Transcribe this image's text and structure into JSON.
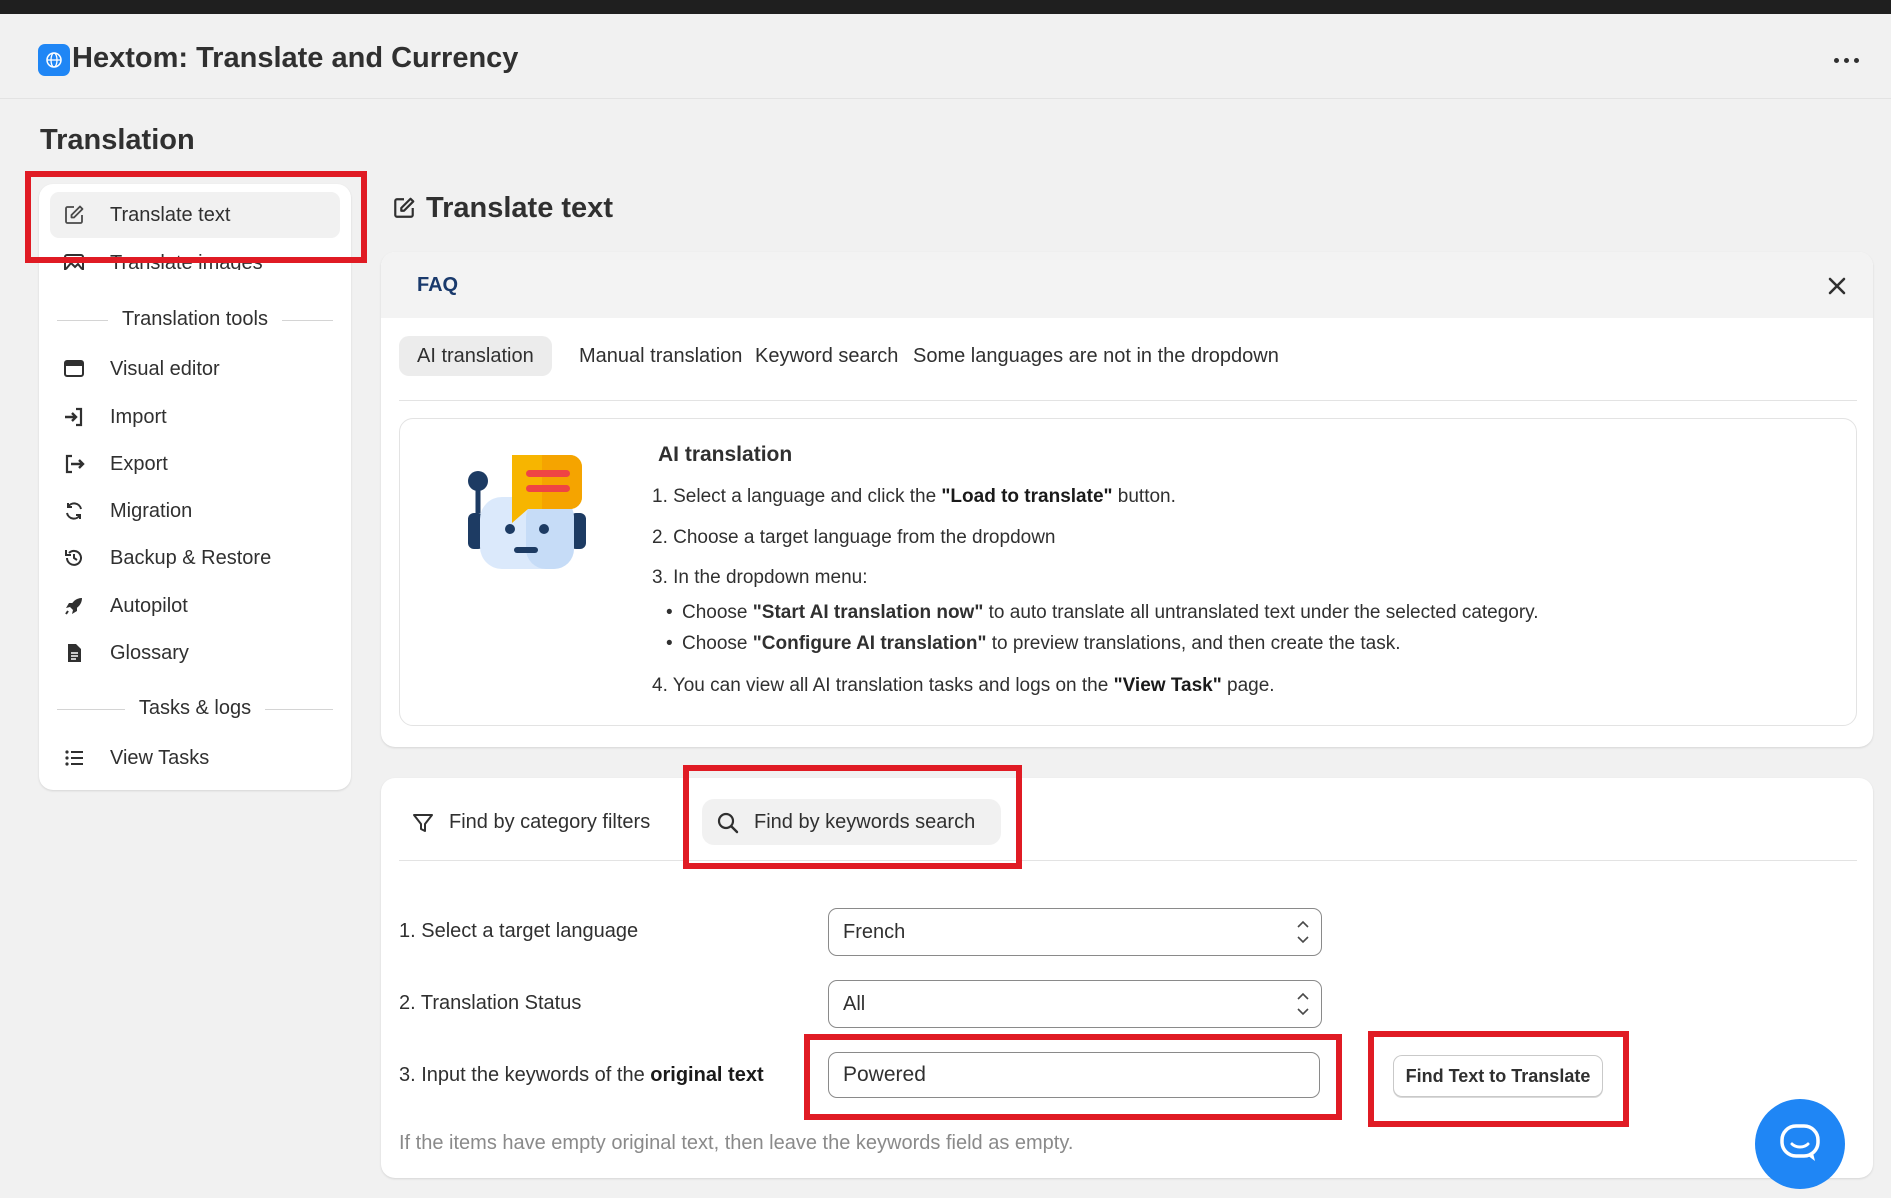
{
  "app": {
    "title": "Hextom: Translate and Currency",
    "icon": "globe-icon"
  },
  "page": {
    "section_title": "Translation"
  },
  "sidebar": {
    "items": [
      {
        "label": "Translate text",
        "icon": "edit-icon",
        "active": true
      },
      {
        "label": "Translate images",
        "icon": "image-icon"
      }
    ],
    "tools_heading": "Translation tools",
    "tools": [
      {
        "label": "Visual editor",
        "icon": "browser-window-icon"
      },
      {
        "label": "Import",
        "icon": "import-icon"
      },
      {
        "label": "Export",
        "icon": "export-icon"
      },
      {
        "label": "Migration",
        "icon": "refresh-icon"
      },
      {
        "label": "Backup & Restore",
        "icon": "history-icon"
      },
      {
        "label": "Autopilot",
        "icon": "rocket-icon"
      },
      {
        "label": "Glossary",
        "icon": "document-icon"
      }
    ],
    "tasks_heading": "Tasks & logs",
    "tasks": [
      {
        "label": "View Tasks",
        "icon": "list-icon"
      }
    ]
  },
  "main": {
    "heading": "Translate text",
    "heading_icon": "edit-icon"
  },
  "faq": {
    "title": "FAQ",
    "tabs": [
      "AI translation",
      "Manual translation",
      "Keyword search",
      "Some languages are not in the dropdown"
    ],
    "active_tab": "AI translation",
    "content": {
      "title": "AI translation",
      "illustration": "robot-chat-icon",
      "step1_a": "1. Select a language and click the ",
      "step1_b": "\"Load to translate\"",
      "step1_c": " button.",
      "step2": "2. Choose a target language from the dropdown",
      "step3": "3. In the dropdown menu:",
      "bullet1_a": "Choose ",
      "bullet1_b": "\"Start AI translation now\"",
      "bullet1_c": " to auto translate all untranslated text under the selected category.",
      "bullet2_a": "Choose ",
      "bullet2_b": "\"Configure AI translation\"",
      "bullet2_c": " to preview translations, and then create the task.",
      "step4_a": "4. You can view all AI translation tasks and logs on the ",
      "step4_b": "\"View Task\"",
      "step4_c": " page."
    }
  },
  "search": {
    "mode_tabs": [
      {
        "label": "Find by category filters",
        "icon": "filter-icon"
      },
      {
        "label": "Find by keywords search",
        "icon": "search-icon",
        "active": true
      }
    ],
    "field1_label": "1. Select a target language",
    "field1_value": "French",
    "field2_label": "2. Translation Status",
    "field2_value": "All",
    "field3_label_a": "3. Input the keywords of the ",
    "field3_label_b": "original text",
    "field3_value": "Powered",
    "find_button": "Find Text to Translate",
    "hint": "If the items have empty original text, then leave the keywords field as empty."
  },
  "colors": {
    "highlight": "#e01b24",
    "accent": "#1f86f5",
    "faq_title": "#1a3a6c"
  }
}
